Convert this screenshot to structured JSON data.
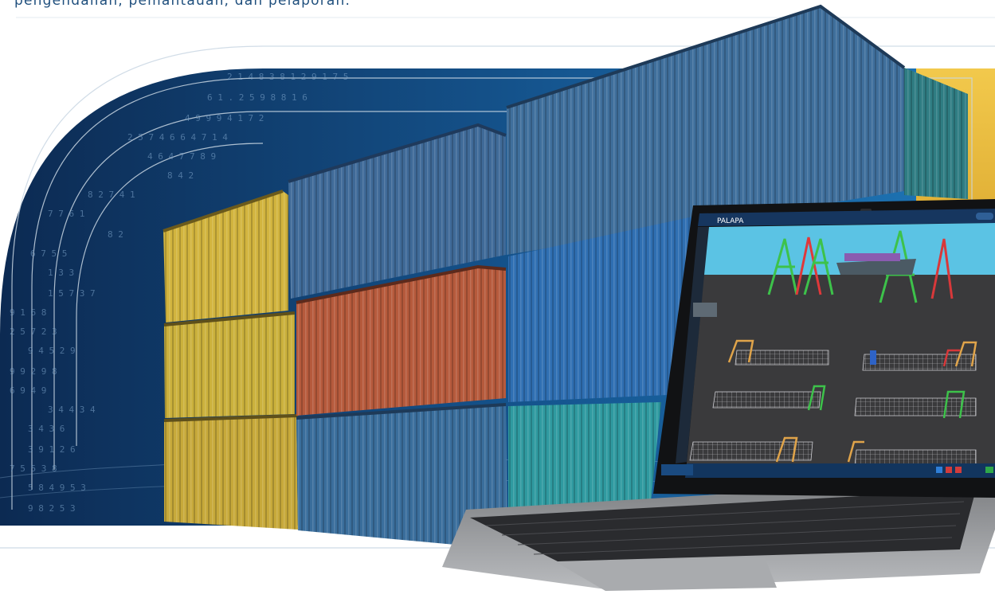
{
  "caption": "pengendalian, pemantauan, dan pelaporan.",
  "laptop": {
    "brand": "PALAPA",
    "screen_colors": {
      "sky": "#5bc3e4",
      "yard": "#3a3a3c",
      "sidebar": "#1d2a3a",
      "taskbar": "#12355e"
    }
  },
  "colors": {
    "arch_dark": "#0e2e58",
    "arch_light": "#1e77b8",
    "gold": "#e9b93a",
    "line": "#c9d7e3"
  },
  "containers": [
    {
      "name": "yellow",
      "color": "#d2b43e"
    },
    {
      "name": "blue",
      "color": "#3f6a98"
    },
    {
      "name": "orange",
      "color": "#b65a3c"
    },
    {
      "name": "teal",
      "color": "#2f8c92"
    }
  ]
}
